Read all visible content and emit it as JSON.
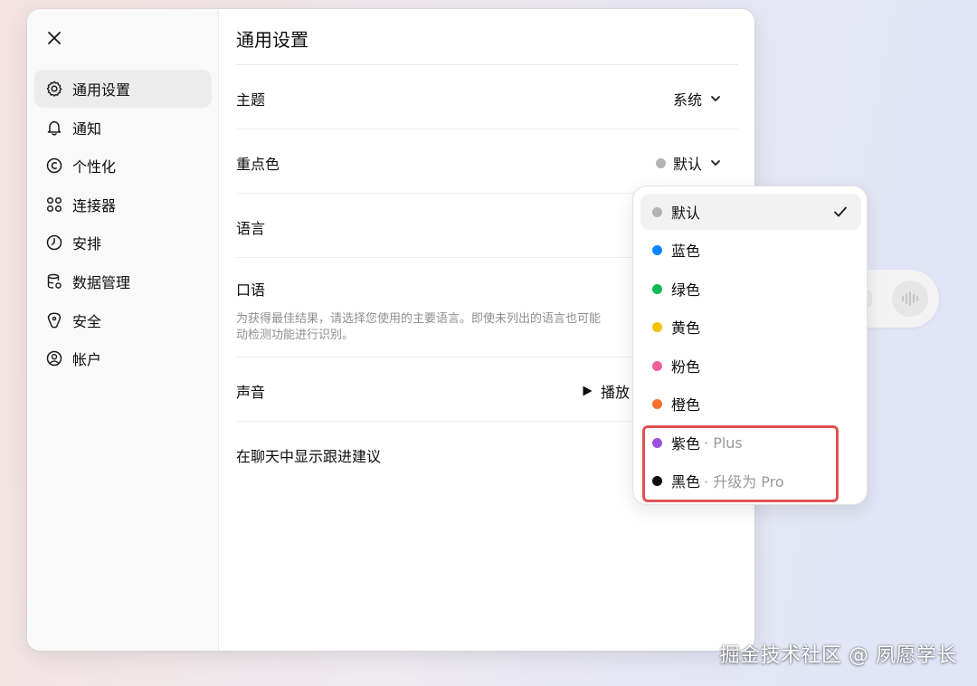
{
  "sidebar": {
    "close_icon": "close-icon",
    "items": [
      {
        "label": "通用设置",
        "icon": "gear-icon",
        "active": true
      },
      {
        "label": "通知",
        "icon": "bell-icon"
      },
      {
        "label": "个性化",
        "icon": "personalization-icon"
      },
      {
        "label": "连接器",
        "icon": "connectors-icon"
      },
      {
        "label": "安排",
        "icon": "clock-icon"
      },
      {
        "label": "数据管理",
        "icon": "database-icon"
      },
      {
        "label": "安全",
        "icon": "shield-icon"
      },
      {
        "label": "帐户",
        "icon": "account-icon"
      }
    ]
  },
  "main": {
    "title": "通用设置",
    "rows": {
      "theme": {
        "label": "主题",
        "value": "系统"
      },
      "accent": {
        "label": "重点色",
        "value": "默认"
      },
      "language": {
        "label": "语言"
      },
      "spoken": {
        "label": "口语",
        "description_line1": "为获得最佳结果，请选择您使用的主要语言。即使未列出的语言也可能",
        "description_line2": "动检测功能进行识别。"
      },
      "voice": {
        "label": "声音",
        "value": "播放"
      },
      "followup": {
        "label": "在聊天中显示跟进建议"
      }
    }
  },
  "dropdown": {
    "options": [
      {
        "label": "默认",
        "color": "#b4b4b4",
        "selected": true
      },
      {
        "label": "蓝色",
        "color": "#0b84ff"
      },
      {
        "label": "绿色",
        "color": "#10b956"
      },
      {
        "label": "黄色",
        "color": "#f2c300"
      },
      {
        "label": "粉色",
        "color": "#f0609e"
      },
      {
        "label": "橙色",
        "color": "#f3722c"
      },
      {
        "label": "紫色",
        "color": "#9b51e0",
        "suffix": "· Plus"
      },
      {
        "label": "黑色",
        "color": "#0d0d0d",
        "suffix": "· 升级为 Pro"
      }
    ],
    "highlight_color": "#e05252"
  },
  "watermark": "掘金技术社区 @ 夙愿学长"
}
